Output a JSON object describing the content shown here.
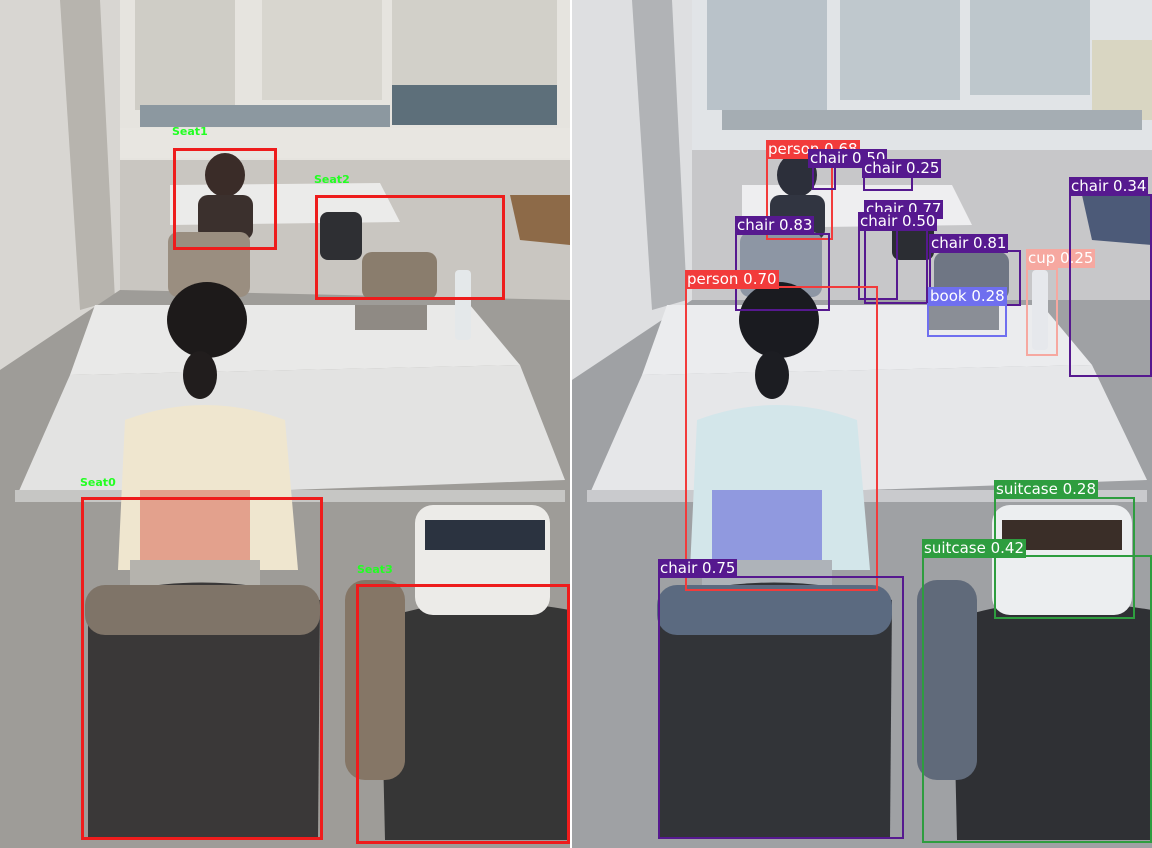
{
  "colors": {
    "seat_box": "#ee1c1c",
    "seat_label": "#22ff22",
    "person": "#f23b3b",
    "chair": "#56198f",
    "book": "#6f6fef",
    "cup": "#f6a8a0",
    "suitcase": "#2e9d3f"
  },
  "left_panel": {
    "seats": [
      {
        "label": "Seat1"
      },
      {
        "label": "Seat2"
      },
      {
        "label": "Seat0"
      },
      {
        "label": "Seat3"
      }
    ]
  },
  "right_panel": {
    "detections": [
      {
        "label": "person 0.68",
        "class": "person"
      },
      {
        "label": "chair 0.50",
        "class": "chair"
      },
      {
        "label": "chair 0.25",
        "class": "chair"
      },
      {
        "label": "chair 0.77",
        "class": "chair"
      },
      {
        "label": "chair 0.50",
        "class": "chair"
      },
      {
        "label": "chair 0.83",
        "class": "chair"
      },
      {
        "label": "chair 0.81",
        "class": "chair"
      },
      {
        "label": "person 0.70",
        "class": "person"
      },
      {
        "label": "book 0.28",
        "class": "book"
      },
      {
        "label": "cup 0.25",
        "class": "cup"
      },
      {
        "label": "chair 0.34",
        "class": "chair"
      },
      {
        "label": "suitcase 0.28",
        "class": "suitcase"
      },
      {
        "label": "suitcase 0.42",
        "class": "suitcase"
      },
      {
        "label": "chair 0.75",
        "class": "chair"
      }
    ]
  }
}
